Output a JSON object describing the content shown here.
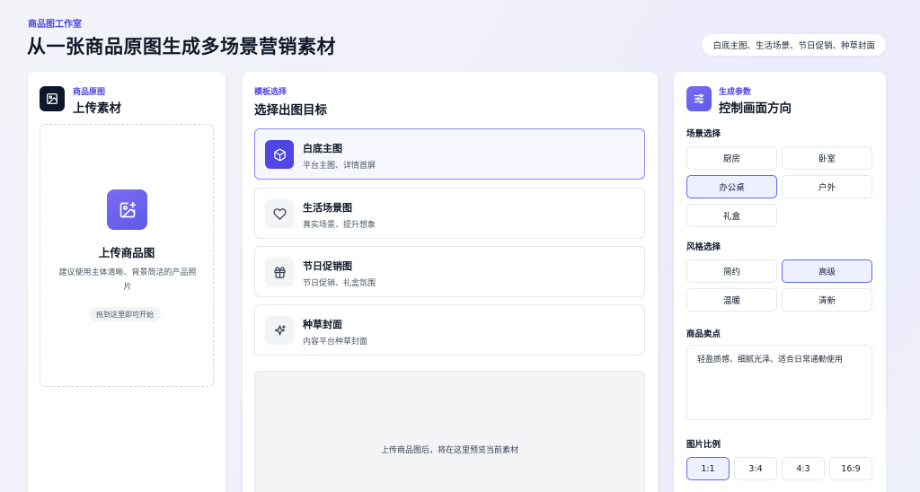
{
  "header": {
    "brand": "商品图工作室",
    "title": "从一张商品原图生成多场景营销素材",
    "chips": "白底主图、生活场景、节日促销、种草封面"
  },
  "upload": {
    "eyebrow": "商品原图",
    "title": "上传素材",
    "cta_title": "上传商品图",
    "cta_desc": "建议使用主体清晰、背景简洁的产品照片",
    "hint": "拖到这里即可开始"
  },
  "templates": {
    "eyebrow": "模板选择",
    "title": "选择出图目标",
    "items": [
      {
        "name": "白底主图",
        "desc": "平台主图、详情首屏",
        "icon": "cube-icon",
        "active": true
      },
      {
        "name": "生活场景图",
        "desc": "真实场景、提升想象",
        "icon": "heart-icon",
        "active": false
      },
      {
        "name": "节日促销图",
        "desc": "节日促销、礼盒氛围",
        "icon": "gift-icon",
        "active": false
      },
      {
        "name": "种草封面",
        "desc": "内容平台种草封面",
        "icon": "sparkle-icon",
        "active": false
      }
    ],
    "preview_text": "上传商品图后，将在这里预览当前素材"
  },
  "params": {
    "eyebrow": "生成参数",
    "title": "控制画面方向",
    "scene_label": "场景选择",
    "scenes": [
      "厨房",
      "卧室",
      "办公桌",
      "户外",
      "礼盒"
    ],
    "scene_selected": "办公桌",
    "style_label": "风格选择",
    "styles": [
      "简约",
      "高级",
      "温暖",
      "清新"
    ],
    "style_selected": "高级",
    "selling_label": "商品卖点",
    "selling_value": "轻盈质感、细腻光泽、适合日常通勤使用",
    "ratio_label": "图片比例",
    "ratios": [
      "1:1",
      "3:4",
      "4:3",
      "16:9"
    ],
    "ratio_selected": "1:1"
  },
  "colors": {
    "accent": "#4f46e5",
    "accent_border": "#6366f1",
    "active_bg": "#eef0fd"
  }
}
